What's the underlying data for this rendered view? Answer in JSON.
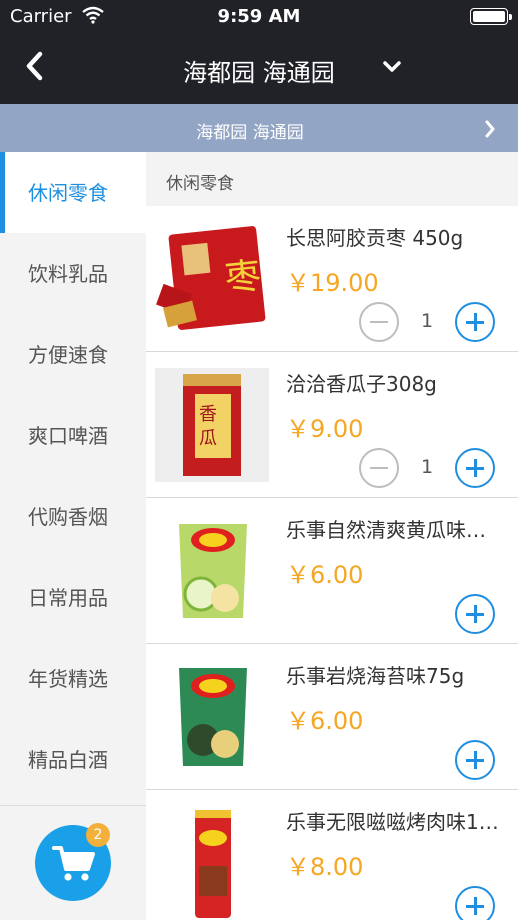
{
  "status_bar": {
    "carrier": "Carrier",
    "time": "9:59 AM"
  },
  "nav": {
    "title": "海都园 海通园"
  },
  "subbar": {
    "label": "海都园 海通园"
  },
  "sidebar": {
    "categories": [
      {
        "label": "休闲零食",
        "active": true
      },
      {
        "label": "饮料乳品",
        "active": false
      },
      {
        "label": "方便速食",
        "active": false
      },
      {
        "label": "爽口啤酒",
        "active": false
      },
      {
        "label": "代购香烟",
        "active": false
      },
      {
        "label": "日常用品",
        "active": false
      },
      {
        "label": "年货精选",
        "active": false
      },
      {
        "label": "精品白酒",
        "active": false
      }
    ]
  },
  "cart": {
    "count": "2"
  },
  "section": {
    "title": "休闲零食"
  },
  "products": [
    {
      "name": "长思阿胶贡枣 450g",
      "price": "￥19.00",
      "quantity": "1",
      "image": "red-date-snack-pack"
    },
    {
      "name": "洽洽香瓜子308g",
      "price": "￥9.00",
      "quantity": "1",
      "image": "melon-seeds-pack"
    },
    {
      "name": "乐事自然清爽黄瓜味…",
      "price": "￥6.00",
      "quantity": "",
      "image": "lays-cucumber-pack"
    },
    {
      "name": "乐事岩烧海苔味75g",
      "price": "￥6.00",
      "quantity": "",
      "image": "lays-seaweed-pack"
    },
    {
      "name": "乐事无限嗞嗞烤肉味1…",
      "price": "￥8.00",
      "quantity": "",
      "image": "lays-bbq-can"
    }
  ],
  "colors": {
    "header_bg": "#212228",
    "subbar_bg": "#93a5c4",
    "accent_blue": "#1e8ee0",
    "price_orange": "#f5a623",
    "badge_orange": "#f3b03a",
    "sidebar_bg": "#f3f3f3"
  }
}
